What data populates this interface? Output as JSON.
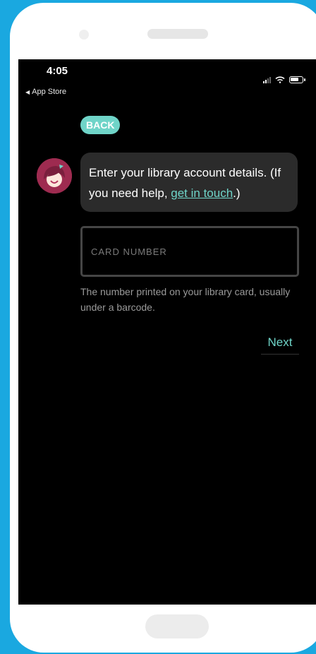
{
  "status_bar": {
    "time": "4:05",
    "back_app": "App Store"
  },
  "nav": {
    "back_label": "BACK"
  },
  "message": {
    "text_before_link": "Enter your library account details. (If you need help, ",
    "link_text": "get in touch",
    "text_after_link": ".)"
  },
  "card_field": {
    "placeholder": "CARD NUMBER",
    "value": "",
    "hint": "The number printed on your library card, usually under a barcode."
  },
  "actions": {
    "next_label": "Next"
  },
  "colors": {
    "accent": "#6fd4c8",
    "background": "#000000",
    "bubble": "#2b2b2b",
    "frame": "#1aa8e0"
  }
}
